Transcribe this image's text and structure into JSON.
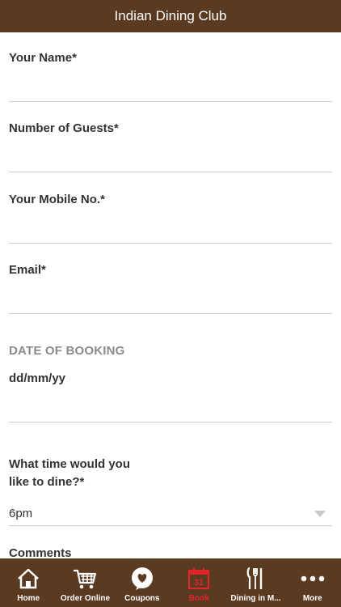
{
  "header": {
    "title": "Indian Dining Club"
  },
  "form": {
    "name_label": "Your Name*",
    "guests_label": "Number of Guests*",
    "mobile_label": "Your Mobile No.*",
    "email_label": "Email*",
    "date_section": "DATE OF BOOKING",
    "date_value": "dd/mm/yy",
    "time_label_line1": "What time would you",
    "time_label_line2": "like to dine?*",
    "time_value": "6pm",
    "comments_label": "Comments"
  },
  "tabs": [
    {
      "label": "Home",
      "icon": "home-icon"
    },
    {
      "label": "Order Online",
      "icon": "cart-icon"
    },
    {
      "label": "Coupons",
      "icon": "heart-badge-icon"
    },
    {
      "label": "Book",
      "icon": "calendar-icon",
      "calendar_day": "31",
      "active": true
    },
    {
      "label": "Dining in M...",
      "icon": "cutlery-icon"
    },
    {
      "label": "More",
      "icon": "more-dots-icon"
    }
  ],
  "colors": {
    "brand": "#5b3a22",
    "active_tab": "#e0242a"
  }
}
